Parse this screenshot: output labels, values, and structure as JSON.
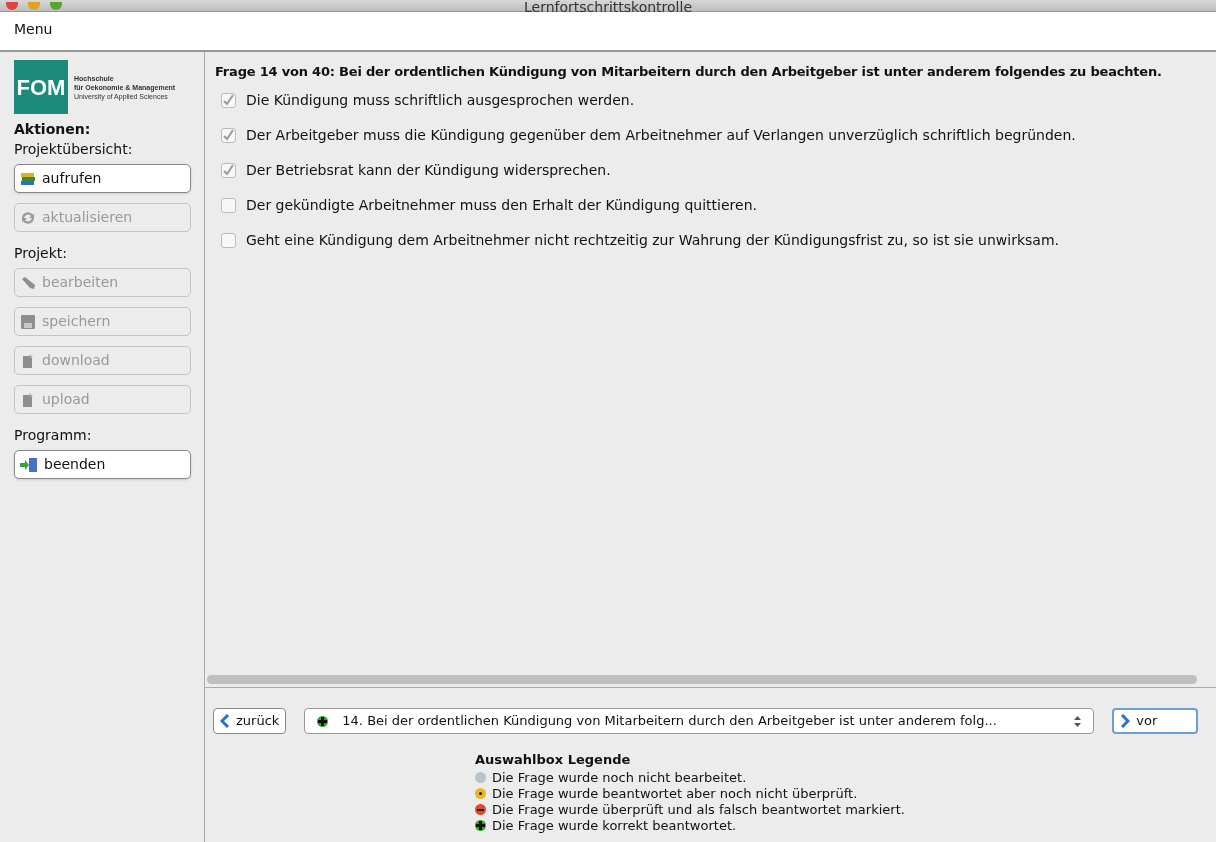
{
  "window": {
    "title": "Lernfortschrittskontrolle"
  },
  "menu": [
    "Menu"
  ],
  "logo": {
    "mark": "FOM",
    "lines": [
      "Hochschule",
      "für Oekonomie & Management",
      "University of Applied Sciences"
    ]
  },
  "sidebar": [
    {
      "kind": "heading",
      "label": "Aktionen:"
    },
    {
      "kind": "label",
      "label": "Projektübersicht:"
    },
    {
      "kind": "button",
      "label": "aufrufen",
      "disabled": false
    },
    {
      "kind": "button",
      "label": "aktualisieren",
      "disabled": true
    },
    {
      "kind": "label",
      "label": "Projekt:"
    },
    {
      "kind": "button",
      "label": "bearbeiten",
      "disabled": true
    },
    {
      "kind": "button",
      "label": "speichern",
      "disabled": true
    },
    {
      "kind": "button",
      "label": "download",
      "disabled": true
    },
    {
      "kind": "button",
      "label": "upload",
      "disabled": true
    },
    {
      "kind": "label",
      "label": "Programm:"
    },
    {
      "kind": "button",
      "label": "beenden",
      "disabled": false
    }
  ],
  "question": {
    "title": "Frage 14 von 40: Bei der ordentlichen Kündigung von Mitarbeitern durch den Arbeitgeber ist unter anderem folgendes zu beachten.",
    "answers": [
      {
        "text": "Die Kündigung muss schriftlich ausgesprochen werden.",
        "checked": true
      },
      {
        "text": "Der Arbeitgeber muss die Kündigung gegenüber dem Arbeitnehmer auf Verlangen unverzüglich schriftlich begründen.",
        "checked": true
      },
      {
        "text": "Der Betriebsrat kann der Kündigung widersprechen.",
        "checked": true
      },
      {
        "text": "Der gekündigte Arbeitnehmer muss den Erhalt der Kündigung quittieren.",
        "checked": false
      },
      {
        "text": "Geht eine Kündigung dem Arbeitnehmer nicht rechtzeitig zur Wahrung der Kündigungsfrist zu, so ist sie unwirksam.",
        "checked": false
      }
    ]
  },
  "navigation": {
    "back": "zurück",
    "next": "vor",
    "select": {
      "kind": "plus",
      "color": "#2aa830",
      "text": "14. Bei der ordentlichen Kündigung von Mitarbeitern durch den Arbeitgeber ist unter anderem folg..."
    }
  },
  "legend": {
    "title": "Auswahlbox Legende",
    "items": [
      {
        "kind": "plain",
        "color": "#b8c4cc",
        "text": "Die Frage wurde noch nicht bearbeitet."
      },
      {
        "kind": "dot",
        "color": "#e8b820",
        "text": "Die Frage wurde beantwortet aber noch nicht überprüft."
      },
      {
        "kind": "minus",
        "color": "#e04a2a",
        "text": "Die Frage wurde überprüft und als falsch beantwortet markiert."
      },
      {
        "kind": "plus",
        "color": "#2aa830",
        "text": "Die Frage wurde korrekt beantwortet."
      }
    ]
  }
}
